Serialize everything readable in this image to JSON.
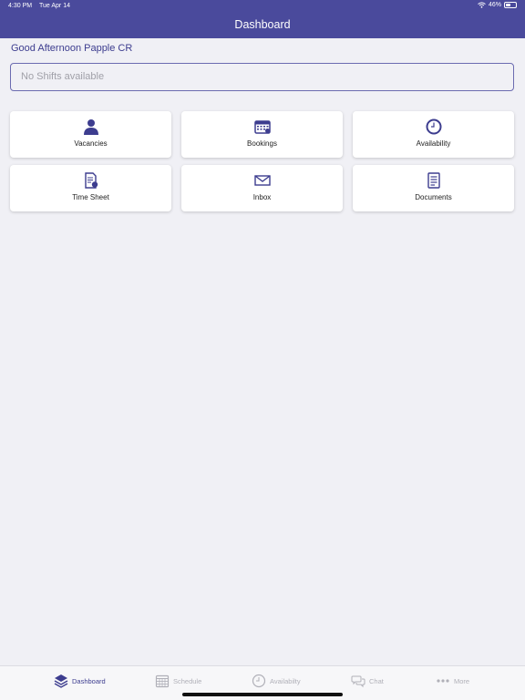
{
  "status_bar": {
    "time": "4:30 PM",
    "date": "Tue Apr 14",
    "battery": "46%",
    "battery_level": 0.46
  },
  "header": {
    "title": "Dashboard"
  },
  "greeting": "Good Afternoon Papple CR",
  "shifts": {
    "placeholder": "No Shifts available"
  },
  "tiles": [
    {
      "label": "Vacancies",
      "icon": "person-icon"
    },
    {
      "label": "Bookings",
      "icon": "calendar-icon"
    },
    {
      "label": "Availability",
      "icon": "clock-icon"
    },
    {
      "label": "Time Sheet",
      "icon": "timesheet-icon"
    },
    {
      "label": "Inbox",
      "icon": "envelope-icon"
    },
    {
      "label": "Documents",
      "icon": "document-icon"
    }
  ],
  "tabbar": [
    {
      "label": "Dashboard",
      "icon": "layers-icon",
      "active": true
    },
    {
      "label": "Schedule",
      "icon": "calendar-icon",
      "active": false
    },
    {
      "label": "Availabilty",
      "icon": "clock-icon",
      "active": false
    },
    {
      "label": "Chat",
      "icon": "chat-bubbles-icon",
      "active": false
    },
    {
      "label": "More",
      "icon": "more-dots-icon",
      "active": false
    }
  ],
  "colors": {
    "brand": "#4a4a9c",
    "accent": "#3d3d8f",
    "background": "#f0f0f5",
    "inactive": "#b0b0b8"
  }
}
